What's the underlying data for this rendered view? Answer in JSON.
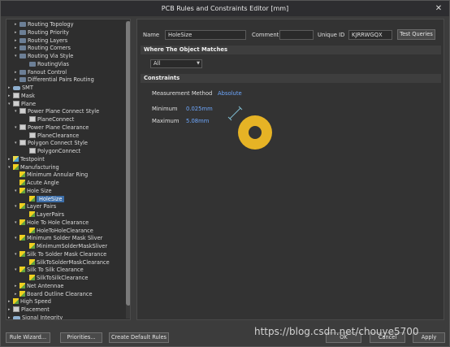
{
  "window": {
    "title": "PCB Rules and Constraints Editor [mm]",
    "close_glyph": "✕"
  },
  "tree": [
    {
      "label": "Routing Topology",
      "indent": 2,
      "arrow": "▸",
      "icon": "cat"
    },
    {
      "label": "Routing Priority",
      "indent": 2,
      "arrow": "▸",
      "icon": "cat"
    },
    {
      "label": "Routing Layers",
      "indent": 2,
      "arrow": "▸",
      "icon": "cat"
    },
    {
      "label": "Routing Corners",
      "indent": 2,
      "arrow": "▸",
      "icon": "cat"
    },
    {
      "label": "Routing Via Style",
      "indent": 2,
      "arrow": "▾",
      "icon": "cat"
    },
    {
      "label": "RoutingVias",
      "indent": 3,
      "arrow": "",
      "icon": "cat"
    },
    {
      "label": "Fanout Control",
      "indent": 2,
      "arrow": "▸",
      "icon": "cat"
    },
    {
      "label": "Differential Pairs Routing",
      "indent": 2,
      "arrow": "▸",
      "icon": "cat"
    },
    {
      "label": "SMT",
      "indent": 1,
      "arrow": "▸",
      "icon": "conn"
    },
    {
      "label": "Mask",
      "indent": 1,
      "arrow": "▸",
      "icon": "rule"
    },
    {
      "label": "Plane",
      "indent": 1,
      "arrow": "▾",
      "icon": "rule"
    },
    {
      "label": "Power Plane Connect Style",
      "indent": 2,
      "arrow": "▾",
      "icon": "rule"
    },
    {
      "label": "PlaneConnect",
      "indent": 3,
      "arrow": "",
      "icon": "rule"
    },
    {
      "label": "Power Plane Clearance",
      "indent": 2,
      "arrow": "▾",
      "icon": "rule"
    },
    {
      "label": "PlaneClearance",
      "indent": 3,
      "arrow": "",
      "icon": "rule"
    },
    {
      "label": "Polygon Connect Style",
      "indent": 2,
      "arrow": "▾",
      "icon": "rule"
    },
    {
      "label": "PolygonConnect",
      "indent": 3,
      "arrow": "",
      "icon": "rule"
    },
    {
      "label": "Testpoint",
      "indent": 1,
      "arrow": "▸",
      "icon": "leaf"
    },
    {
      "label": "Manufacturing",
      "indent": 1,
      "arrow": "▾",
      "icon": "mfg"
    },
    {
      "label": "Minimum Annular Ring",
      "indent": 2,
      "arrow": "",
      "icon": "mfg"
    },
    {
      "label": "Acute Angle",
      "indent": 2,
      "arrow": "",
      "icon": "mfg"
    },
    {
      "label": "Hole Size",
      "indent": 2,
      "arrow": "▾",
      "icon": "mfg"
    },
    {
      "label": "HoleSize",
      "indent": 3,
      "arrow": "",
      "icon": "mfg",
      "selected": true
    },
    {
      "label": "Layer Pairs",
      "indent": 2,
      "arrow": "▾",
      "icon": "mfg"
    },
    {
      "label": "LayerPairs",
      "indent": 3,
      "arrow": "",
      "icon": "mfg"
    },
    {
      "label": "Hole To Hole Clearance",
      "indent": 2,
      "arrow": "▾",
      "icon": "mfg"
    },
    {
      "label": "HoleToHoleClearance",
      "indent": 3,
      "arrow": "",
      "icon": "mfg"
    },
    {
      "label": "Minimum Solder Mask Sliver",
      "indent": 2,
      "arrow": "▾",
      "icon": "mfg"
    },
    {
      "label": "MinimumSolderMaskSliver",
      "indent": 3,
      "arrow": "",
      "icon": "mfg"
    },
    {
      "label": "Silk To Solder Mask Clearance",
      "indent": 2,
      "arrow": "▾",
      "icon": "mfg"
    },
    {
      "label": "SilkToSolderMaskClearance",
      "indent": 3,
      "arrow": "",
      "icon": "mfg"
    },
    {
      "label": "Silk To Silk Clearance",
      "indent": 2,
      "arrow": "▾",
      "icon": "mfg"
    },
    {
      "label": "SilkToSilkClearance",
      "indent": 3,
      "arrow": "",
      "icon": "mfg"
    },
    {
      "label": "Net Antennae",
      "indent": 2,
      "arrow": "▸",
      "icon": "mfg"
    },
    {
      "label": "Board Outline Clearance",
      "indent": 2,
      "arrow": "▸",
      "icon": "mfg"
    },
    {
      "label": "High Speed",
      "indent": 1,
      "arrow": "▸",
      "icon": "mfg"
    },
    {
      "label": "Placement",
      "indent": 1,
      "arrow": "▸",
      "icon": "rule"
    },
    {
      "label": "Signal Integrity",
      "indent": 1,
      "arrow": "▸",
      "icon": "conn"
    }
  ],
  "rule": {
    "name_label": "Name",
    "name_value": "HoleSize",
    "comment_label": "Comment",
    "comment_value": "",
    "uid_label": "Unique ID",
    "uid_value": "KJRRWGQX",
    "test_queries": "Test Queries"
  },
  "where": {
    "title": "Where The Object Matches",
    "scope": "All"
  },
  "constraints": {
    "title": "Constraints",
    "method_label": "Measurement Method",
    "method_value": "Absolute",
    "min_label": "Minimum",
    "min_value": "0.025mm",
    "max_label": "Maximum",
    "max_value": "5.08mm"
  },
  "footer": {
    "rule_wizard": "Rule Wizard...",
    "priorities": "Priorities...",
    "create_default": "Create Default Rules",
    "ok": "OK",
    "cancel": "Cancel",
    "apply": "Apply"
  },
  "watermark": "https://blog.csdn.net/chouye5700",
  "colors": {
    "accent": "#3d6ea8",
    "pad": "#e6b325",
    "hole": "#333333"
  }
}
